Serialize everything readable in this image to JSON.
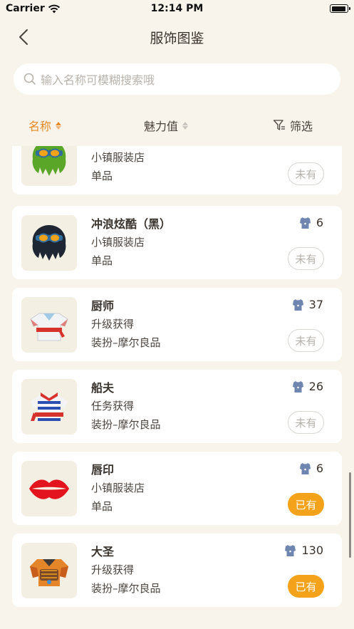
{
  "status_bar": {
    "carrier": "Carrier",
    "time": "12:14 PM"
  },
  "nav": {
    "title": "服饰图鉴"
  },
  "search": {
    "placeholder": "输入名称可模糊搜索哦"
  },
  "sort": {
    "name_label": "名称",
    "charm_label": "魅力值",
    "filter_label": "筛选"
  },
  "colors": {
    "accent": "#e58a23",
    "owned": "#f4a219",
    "background": "#f8f4ec"
  },
  "items": [
    {
      "name": "",
      "charm": "",
      "source": "小镇服装店",
      "category": "单品",
      "status": "未有",
      "owned": false,
      "icon": "green-hair-goggles-icon"
    },
    {
      "name": "冲浪炫酷（黑）",
      "charm": "6",
      "source": "小镇服装店",
      "category": "单品",
      "status": "未有",
      "owned": false,
      "icon": "black-hair-goggles-icon"
    },
    {
      "name": "厨师",
      "charm": "37",
      "source": "升级获得",
      "category": "装扮–摩尔良品",
      "status": "未有",
      "owned": false,
      "icon": "chef-shirt-icon"
    },
    {
      "name": "船夫",
      "charm": "26",
      "source": "任务获得",
      "category": "装扮–摩尔良品",
      "status": "未有",
      "owned": false,
      "icon": "striped-shirt-icon"
    },
    {
      "name": "唇印",
      "charm": "6",
      "source": "小镇服装店",
      "category": "单品",
      "status": "已有",
      "owned": true,
      "icon": "lips-icon"
    },
    {
      "name": "大圣",
      "charm": "130",
      "source": "升级获得",
      "category": "装扮–摩尔良品",
      "status": "已有",
      "owned": true,
      "icon": "monkey-king-armor-icon"
    }
  ]
}
